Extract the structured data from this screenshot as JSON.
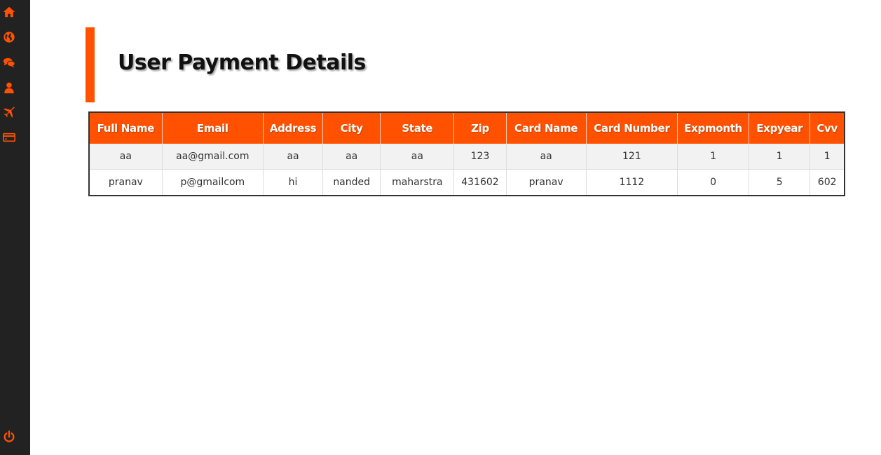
{
  "sidebar": {
    "icons": [
      "home-icon",
      "globe-icon",
      "chat-icon",
      "user-icon",
      "plane-icon",
      "credit-card-icon"
    ],
    "logout_icon": "power-icon"
  },
  "accent_color": "#ff5100",
  "sidebar_color": "#222222",
  "page": {
    "title": "User Payment Details"
  },
  "table": {
    "headers": [
      "Full Name",
      "Email",
      "Address",
      "City",
      "State",
      "Zip",
      "Card Name",
      "Card Number",
      "Expmonth",
      "Expyear",
      "Cvv"
    ],
    "rows": [
      [
        "aa",
        "aa@gmail.com",
        "aa",
        "aa",
        "aa",
        "123",
        "aa",
        "121",
        "1",
        "1",
        "1"
      ],
      [
        "pranav",
        "p@gmailcom",
        "hi",
        "nanded",
        "maharstra",
        "431602",
        "pranav",
        "1112",
        "0",
        "5",
        "602"
      ]
    ]
  }
}
